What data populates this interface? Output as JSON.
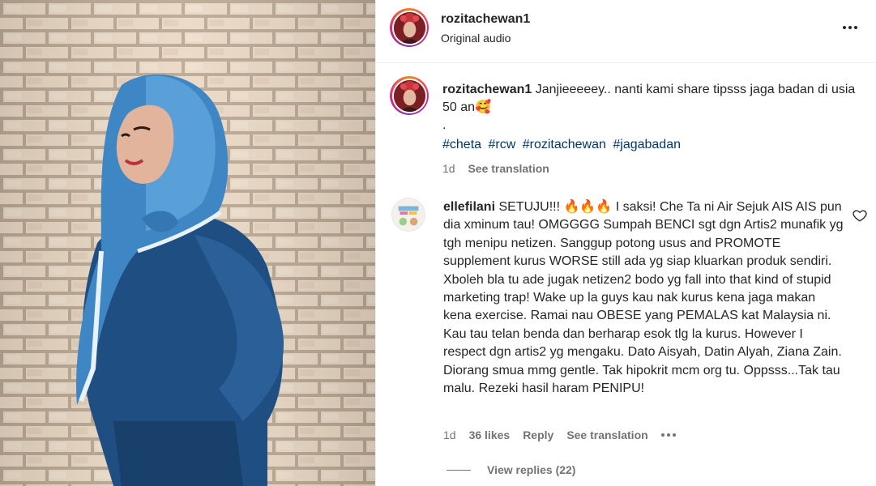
{
  "post": {
    "username": "rozitachewan1",
    "subtitle": "Original audio",
    "more_icon": "more-horizontal-icon"
  },
  "caption": {
    "username": "rozitachewan1",
    "text": "Janjieeeeey.. nanti kami share tipsss jaga badan di usia 50 an🥰",
    "dot": ".",
    "hashtags": [
      "#cheta",
      "#rcw",
      "#rozitachewan",
      "#jagabadan"
    ],
    "time": "1d",
    "see_translation": "See translation"
  },
  "comment": {
    "username": "ellefilani",
    "text": "SETUJU!!! 🔥🔥🔥 I saksi! Che Ta ni Air Sejuk AIS AIS pun dia xminum tau! OMGGGG Sumpah BENCI sgt dgn Artis2 munafik yg tgh menipu netizen. Sanggup potong usus and PROMOTE supplement kurus WORSE still ada yg siap kluarkan produk sendiri. Xboleh bla tu ade jugak netizen2 bodo yg fall into that kind of stupid marketing trap! Wake up la guys kau nak kurus kena jaga makan kena exercise. Ramai nau OBESE yang PEMALAS kat Malaysia ni. Kau tau telan benda dan berharap esok tlg la kurus. However I respect dgn artis2 yg mengaku. Dato Aisyah, Datin Alyah, Ziana Zain. Diorang smua mmg gentle. Tak hipokrit mcm org tu. Oppsss...Tak tau malu. Rezeki hasil haram PENIPU!",
    "time": "1d",
    "likes": "36 likes",
    "reply": "Reply",
    "see_translation": "See translation",
    "view_replies": "View replies (22)",
    "like_icon": "heart-icon"
  },
  "colors": {
    "link": "#00376b",
    "muted": "#737373",
    "text": "#262626",
    "story_ring": "#dd2a7b"
  }
}
